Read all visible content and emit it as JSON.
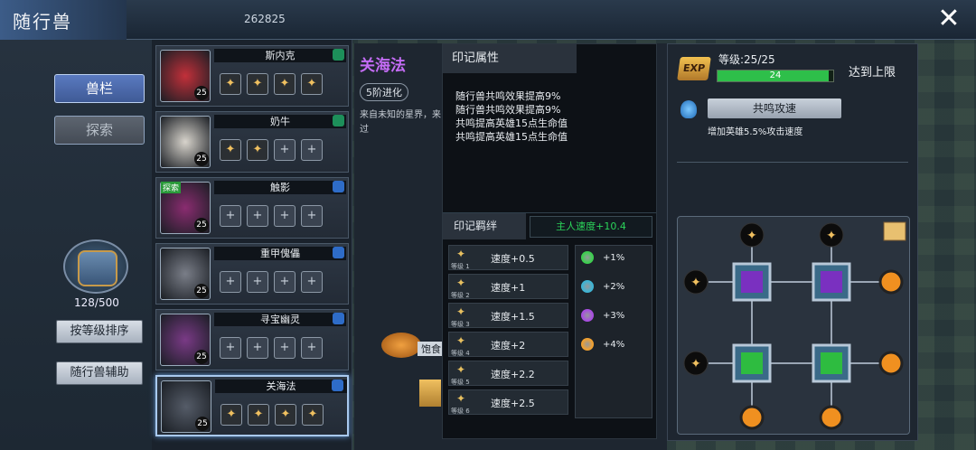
{
  "header": {
    "title": "随行兽",
    "resource_value": "262825",
    "close_icon": "close-icon"
  },
  "sidebar": {
    "tab_pets": "兽栏",
    "tab_explore": "探索",
    "bag_count": "128/500",
    "sort_button": "按等级排序",
    "assist_button": "随行兽辅助"
  },
  "pets": [
    {
      "name": "斯内克",
      "level": "25",
      "tag": "",
      "slots": [
        "on",
        "on",
        "on",
        "on"
      ],
      "color": "#c2303a",
      "badge_color": "#1d8f5a"
    },
    {
      "name": "奶牛",
      "level": "25",
      "tag": "",
      "slots": [
        "on",
        "on",
        "add",
        "add"
      ],
      "color": "#d8d4cc",
      "badge_color": "#1d8f5a"
    },
    {
      "name": "触影",
      "level": "25",
      "tag": "探索",
      "slots": [
        "add",
        "add",
        "add",
        "add"
      ],
      "color": "#8a2c70",
      "badge_color": "#2e6cc8"
    },
    {
      "name": "重甲傀儡",
      "level": "25",
      "tag": "",
      "slots": [
        "add",
        "add",
        "add",
        "add"
      ],
      "color": "#7a7e88",
      "badge_color": "#2e6cc8"
    },
    {
      "name": "寻宝幽灵",
      "level": "25",
      "tag": "",
      "slots": [
        "add",
        "add",
        "add",
        "add"
      ],
      "color": "#7a3a86",
      "badge_color": "#2e6cc8"
    },
    {
      "name": "关海法",
      "level": "25",
      "tag": "",
      "slots": [
        "on",
        "on",
        "on",
        "on"
      ],
      "color": "#555c68",
      "badge_color": "#2e6cc8",
      "selected": true
    }
  ],
  "detail": {
    "name": "关海法",
    "evolution": "5阶进化",
    "description": "来自未知的星界，来过",
    "food_label": "饱食"
  },
  "mark": {
    "header": "印记属性",
    "attributes": [
      "随行兽共鸣效果提高9%",
      "随行兽共鸣效果提高9%",
      "共鸣提高英雄15点生命值",
      "共鸣提高英雄15点生命值"
    ],
    "bond_label": "印记羁绊",
    "bond_bonus": "主人速度+10.4",
    "speed_rows": [
      {
        "level": "等级 1",
        "value": "速度+0.5"
      },
      {
        "level": "等级 2",
        "value": "速度+1"
      },
      {
        "level": "等级 3",
        "value": "速度+1.5"
      },
      {
        "level": "等级 4",
        "value": "速度+2"
      },
      {
        "level": "等级 5",
        "value": "速度+2.2"
      },
      {
        "level": "等级 6",
        "value": "速度+2.5"
      }
    ],
    "percent_rows": [
      {
        "value": "+1%",
        "color": "#3ccf4e"
      },
      {
        "value": "+2%",
        "color": "#3eb4d4"
      },
      {
        "value": "+3%",
        "color": "#a84ee0"
      },
      {
        "value": "+4%",
        "color": "#f0a030"
      }
    ]
  },
  "resonance": {
    "exp_badge": "EXP",
    "level_text": "等级:25/25",
    "bar_value": "24",
    "bar_fill_fraction": 0.96,
    "max_text": "达到上限",
    "skill_name": "共鸣攻速",
    "skill_desc": "增加英雄5.5%攻击速度"
  }
}
